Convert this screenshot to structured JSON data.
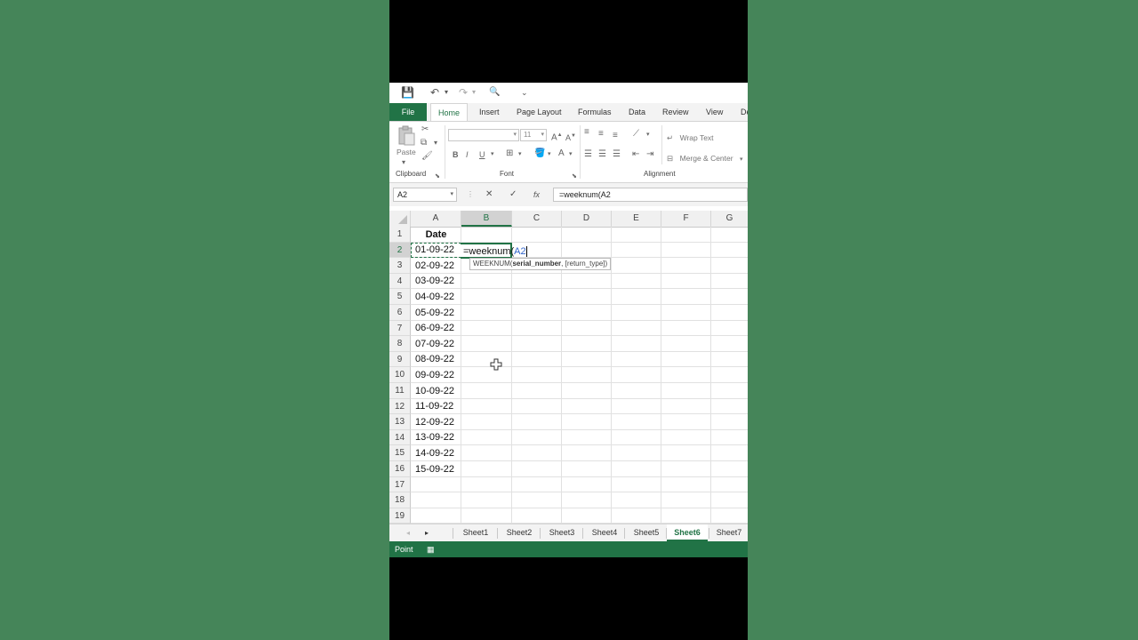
{
  "qat": {
    "save": "💾",
    "undo": "↶",
    "redo": "↷",
    "preview": "🔍",
    "customize": "⌄"
  },
  "tabs": [
    {
      "label": "File"
    },
    {
      "label": "Home"
    },
    {
      "label": "Insert"
    },
    {
      "label": "Page Layout"
    },
    {
      "label": "Formulas"
    },
    {
      "label": "Data"
    },
    {
      "label": "Review"
    },
    {
      "label": "View"
    },
    {
      "label": "De"
    }
  ],
  "ribbon": {
    "clipboard_label": "Clipboard",
    "paste_label": "Paste",
    "font_label": "Font",
    "font_size": "11",
    "bold": "B",
    "italic": "I",
    "underline": "U",
    "grow": "A",
    "shrink": "A",
    "font_color": "A",
    "alignment_label": "Alignment",
    "wrap_text": "Wrap Text",
    "merge_center": "Merge & Center"
  },
  "formula_bar": {
    "name_box": "A2",
    "cancel": "✕",
    "enter": "✓",
    "fx": "fx",
    "formula": "=weeknum(A2"
  },
  "columns": [
    "A",
    "B",
    "C",
    "D",
    "E",
    "F",
    "G"
  ],
  "rows": [
    "1",
    "2",
    "3",
    "4",
    "5",
    "6",
    "7",
    "8",
    "9",
    "10",
    "11",
    "12",
    "13",
    "14",
    "15",
    "16",
    "17",
    "18",
    "19"
  ],
  "cells": {
    "A1": "Date",
    "A": [
      "01-09-22",
      "02-09-22",
      "03-09-22",
      "04-09-22",
      "05-09-22",
      "06-09-22",
      "07-09-22",
      "08-09-22",
      "09-09-22",
      "10-09-22",
      "11-09-22",
      "12-09-22",
      "13-09-22",
      "14-09-22",
      "15-09-22"
    ],
    "B2_prefix": "=weeknum(",
    "B2_ref": "A2"
  },
  "tooltip": {
    "func": "WEEKNUM(",
    "arg1": "serial_number",
    "rest": ", [return_type])"
  },
  "sheets": [
    "Sheet1",
    "Sheet2",
    "Sheet3",
    "Sheet4",
    "Sheet5",
    "Sheet6",
    "Sheet7"
  ],
  "active_sheet": "Sheet6",
  "status": {
    "mode": "Point"
  },
  "colors": {
    "accent": "#217346",
    "background": "#458559"
  }
}
